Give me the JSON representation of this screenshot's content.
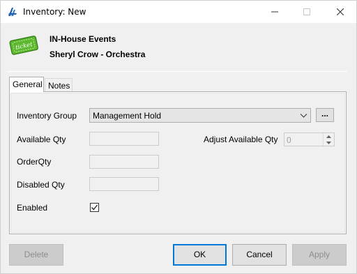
{
  "window": {
    "title": "Inventory: New",
    "icons": {
      "app": "app-logo-icon",
      "minimize": "minimize-icon",
      "maximize": "maximize-icon",
      "close": "close-icon"
    }
  },
  "header": {
    "icon": "ticket-icon",
    "icon_text": "ticket",
    "event_name": "IN-House Events",
    "event_detail": "Sheryl Crow - Orchestra"
  },
  "tabs": [
    {
      "label": "General",
      "selected": true
    },
    {
      "label": "Notes",
      "selected": false
    }
  ],
  "form": {
    "inventory_group": {
      "label": "Inventory Group",
      "value": "Management Hold",
      "browse_label": "..."
    },
    "available_qty": {
      "label": "Available Qty",
      "value": ""
    },
    "adjust_available_qty": {
      "label": "Adjust Available Qty",
      "value": "0"
    },
    "order_qty": {
      "label": "OrderQty",
      "value": ""
    },
    "disabled_qty": {
      "label": "Disabled Qty",
      "value": ""
    },
    "enabled": {
      "label": "Enabled",
      "checked": true
    }
  },
  "buttons": {
    "delete": "Delete",
    "ok": "OK",
    "cancel": "Cancel",
    "apply": "Apply"
  },
  "colors": {
    "accent": "#0078d7",
    "ticket_green": "#5cb82e"
  }
}
